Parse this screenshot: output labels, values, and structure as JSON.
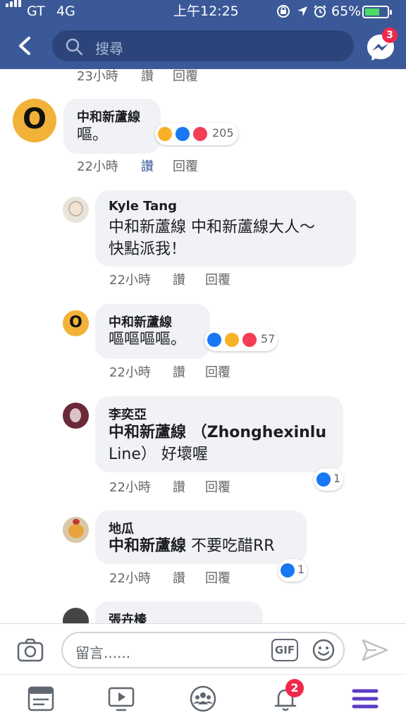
{
  "status_bar": {
    "carrier": "GT",
    "network": "4G",
    "time": "上午12:25",
    "battery": "65%",
    "battery_level": 0.65
  },
  "nav": {
    "search_placeholder": "搜尋",
    "messenger_badge": "3"
  },
  "top_partial": {
    "time": "23小時",
    "like": "讚",
    "reply": "回覆"
  },
  "comments": [
    {
      "avatar_letter": "O",
      "name": "中和新蘆線",
      "lines": [
        "嘔。"
      ],
      "time": "22小時",
      "like": "讚",
      "reply": "回覆",
      "reactions": [
        "haha",
        "like",
        "love"
      ],
      "reaction_count": "205",
      "liked": true
    },
    {
      "name": "Kyle Tang",
      "lines": [
        "中和新蘆線 中和新蘆線大人～",
        "快點派我！"
      ],
      "time": "22小時",
      "like": "讚",
      "reply": "回覆"
    },
    {
      "avatar_letter": "O",
      "name": "中和新蘆線",
      "lines": [
        "嘔嘔嘔嘔。"
      ],
      "time": "22小時",
      "like": "讚",
      "reply": "回覆",
      "reactions": [
        "like",
        "haha",
        "love"
      ],
      "reaction_count": "57"
    },
    {
      "name": "李奕亞",
      "lines": [
        "中和新蘆線 （Zhonghexinlu",
        "Line） 好壞喔"
      ],
      "time": "22小時",
      "like": "讚",
      "reply": "回覆",
      "reactions": [
        "like"
      ],
      "reaction_count": "1"
    },
    {
      "name": "地瓜",
      "lines": [
        "中和新蘆線 不要吃醋RR"
      ],
      "time": "22小時",
      "like": "讚",
      "reply": "回覆",
      "reactions": [
        "like"
      ],
      "reaction_count": "1"
    },
    {
      "name": "張卉榛"
    }
  ],
  "composer": {
    "placeholder": "留言......",
    "gif_label": "GIF"
  },
  "tab_bar": {
    "notifications_badge": "2"
  },
  "colors": {
    "brand_blue": "#3b5998",
    "like_blue": "#1877f2",
    "badge_red": "#f02849",
    "bubble_gray": "#f0f2f5"
  }
}
